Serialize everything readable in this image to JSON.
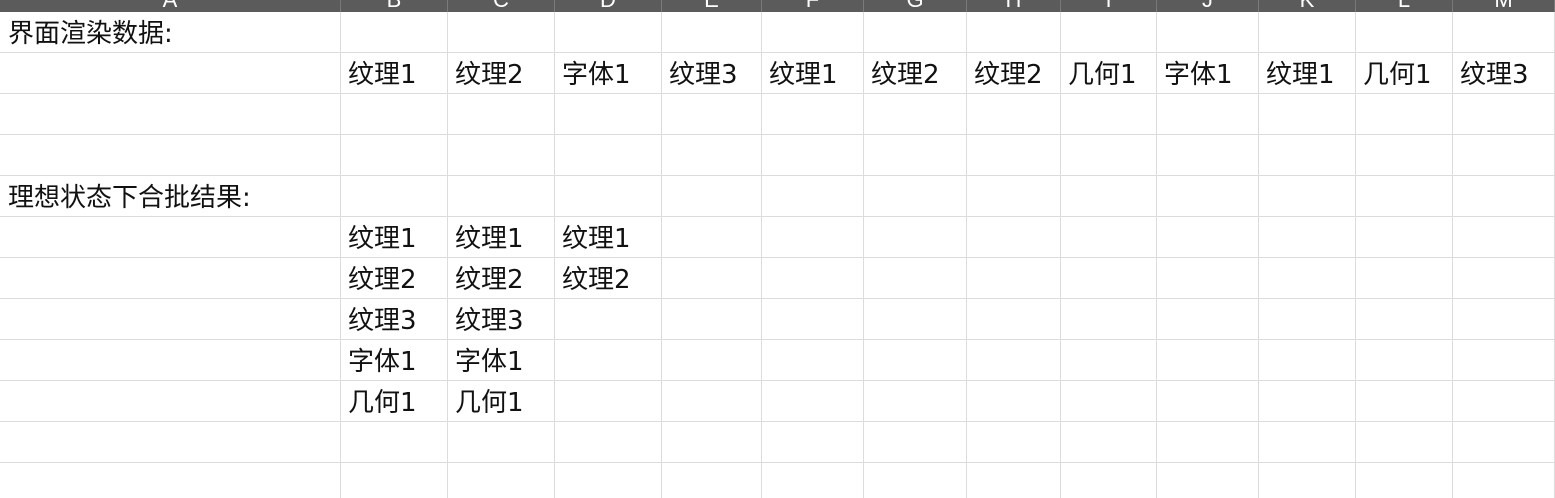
{
  "columns": [
    "A",
    "B",
    "C",
    "D",
    "E",
    "F",
    "G",
    "H",
    "I",
    "J",
    "K",
    "L",
    "M"
  ],
  "rows": [
    {
      "cells": [
        "界面渲染数据:",
        "",
        "",
        "",
        "",
        "",
        "",
        "",
        "",
        "",
        "",
        "",
        ""
      ]
    },
    {
      "cells": [
        "",
        "纹理1",
        "纹理2",
        "字体1",
        "纹理3",
        "纹理1",
        "纹理2",
        "纹理2",
        "几何1",
        "字体1",
        "纹理1",
        "几何1",
        "纹理3"
      ]
    },
    {
      "cells": [
        "",
        "",
        "",
        "",
        "",
        "",
        "",
        "",
        "",
        "",
        "",
        "",
        ""
      ]
    },
    {
      "cells": [
        "",
        "",
        "",
        "",
        "",
        "",
        "",
        "",
        "",
        "",
        "",
        "",
        ""
      ]
    },
    {
      "cells": [
        "理想状态下合批结果:",
        "",
        "",
        "",
        "",
        "",
        "",
        "",
        "",
        "",
        "",
        "",
        ""
      ]
    },
    {
      "cells": [
        "",
        "纹理1",
        "纹理1",
        "纹理1",
        "",
        "",
        "",
        "",
        "",
        "",
        "",
        "",
        ""
      ]
    },
    {
      "cells": [
        "",
        "纹理2",
        "纹理2",
        "纹理2",
        "",
        "",
        "",
        "",
        "",
        "",
        "",
        "",
        ""
      ]
    },
    {
      "cells": [
        "",
        "纹理3",
        "纹理3",
        "",
        "",
        "",
        "",
        "",
        "",
        "",
        "",
        "",
        ""
      ]
    },
    {
      "cells": [
        "",
        "字体1",
        "字体1",
        "",
        "",
        "",
        "",
        "",
        "",
        "",
        "",
        "",
        ""
      ]
    },
    {
      "cells": [
        "",
        "几何1",
        "几何1",
        "",
        "",
        "",
        "",
        "",
        "",
        "",
        "",
        "",
        ""
      ]
    },
    {
      "cells": [
        "",
        "",
        "",
        "",
        "",
        "",
        "",
        "",
        "",
        "",
        "",
        "",
        ""
      ]
    },
    {
      "cells": [
        "",
        "",
        "",
        "",
        "",
        "",
        "",
        "",
        "",
        "",
        "",
        "",
        ""
      ]
    }
  ]
}
